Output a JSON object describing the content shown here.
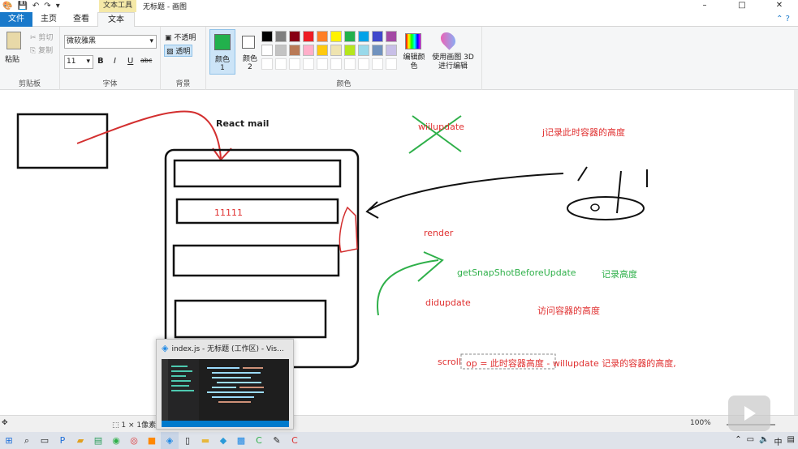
{
  "window": {
    "title": "无标题 - 画图",
    "context_tab": "文本工具",
    "controls": [
      "–",
      "□",
      "✕"
    ]
  },
  "tabs": [
    {
      "label": "文件"
    },
    {
      "label": "主页"
    },
    {
      "label": "查看"
    },
    {
      "label": "文本"
    }
  ],
  "ribbon": {
    "clipboard": {
      "paste": "粘贴",
      "cut": "剪切",
      "copy": "复制",
      "group": "剪贴板"
    },
    "font": {
      "family": "微软雅黑",
      "size": "11",
      "group": "字体",
      "bold": "B",
      "italic": "I",
      "underline": "U",
      "strike": "abc"
    },
    "background": {
      "opaque": "不透明",
      "transparent": "透明",
      "group": "背景"
    },
    "colors": {
      "color1": "颜色 1",
      "color2": "颜色 2",
      "edit": "编辑颜色",
      "paint3d": "使用画图 3D 进行编辑",
      "group": "颜色",
      "color1_value": "#22b14c",
      "palette_row1": [
        "#000000",
        "#7f7f7f",
        "#880015",
        "#ed1c24",
        "#ff7f27",
        "#fff200",
        "#22b14c",
        "#00a2e8",
        "#3f48cc",
        "#a349a4"
      ],
      "palette_row2": [
        "#ffffff",
        "#c3c3c3",
        "#b97a57",
        "#ffaec9",
        "#ffc90e",
        "#efe4b0",
        "#b5e61d",
        "#99d9ea",
        "#7092be",
        "#c8bfe7"
      ]
    }
  },
  "canvas": {
    "react_mail": "React mail",
    "value_11111": "11111",
    "willupdate": "wiilupdate",
    "record_height": "j记录此时容器的高度",
    "render": "render",
    "get_snapshot": "getSnapShotBeforeUpdate",
    "record_label": "记录高度",
    "didupdate": "didupdate",
    "visit_height": "访问容器的高度",
    "scroll_line": "scroll",
    "scroll_top": "op = 此时容器高度 - willupdate 记录的容器的高度,"
  },
  "preview": {
    "title": "index.js - 无标题 (工作区) - Vis..."
  },
  "status": {
    "selection": "1 × 1像素",
    "zoom": "100%"
  },
  "taskbar": {
    "time_partial": "中"
  }
}
